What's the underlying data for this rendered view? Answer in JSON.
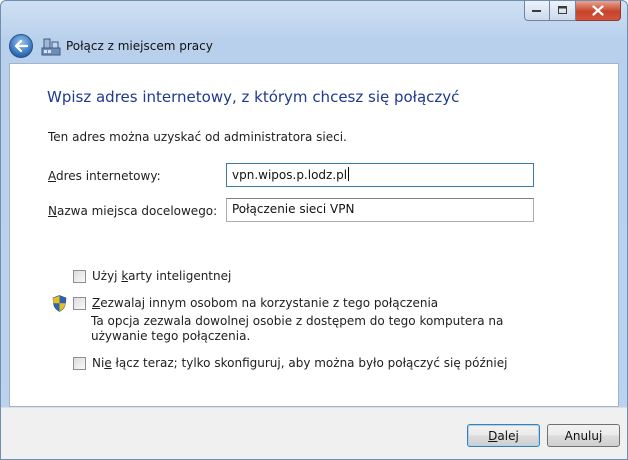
{
  "window": {
    "title": "Połącz z miejscem pracy"
  },
  "content": {
    "heading": "Wpisz adres internetowy, z którym chcesz się połączyć",
    "info": "Ten adres można uzyskać od administratora sieci.",
    "address": {
      "label_mnemonic": "A",
      "label_rest": "dres internetowy:",
      "value": "vpn.wipos.p.lodz.pl"
    },
    "destination": {
      "label_mnemonic": "N",
      "label_rest": "azwa miejsca docelowego:",
      "value": "Połączenie sieci VPN"
    },
    "options": {
      "smart_card": {
        "label_pre": "Użyj ",
        "label_mnemonic": "k",
        "label_post": "arty inteligentnej",
        "checked": false
      },
      "allow_others": {
        "label_pre": "",
        "label_mnemonic": "Z",
        "label_post": "ezwalaj innym osobom na korzystanie z tego połączenia",
        "checked": false,
        "description": "Ta opcja zezwala dowolnej osobie z dostępem do tego komputera na używanie tego połączenia."
      },
      "dont_connect": {
        "label_pre": "Ni",
        "label_mnemonic": "e",
        "label_post": " łącz teraz; tylko skonfiguruj, aby można było połączyć się później",
        "checked": false
      }
    }
  },
  "buttons": {
    "next_mnemonic": "D",
    "next_rest": "alej",
    "cancel": "Anuluj"
  },
  "icons": {
    "back": "back-arrow-icon",
    "network": "network-connection-icon",
    "shield": "uac-shield-icon"
  },
  "colors": {
    "heading": "#1e3a8f",
    "titlebar": "#bcd3ee",
    "close_button": "#c7432b"
  }
}
